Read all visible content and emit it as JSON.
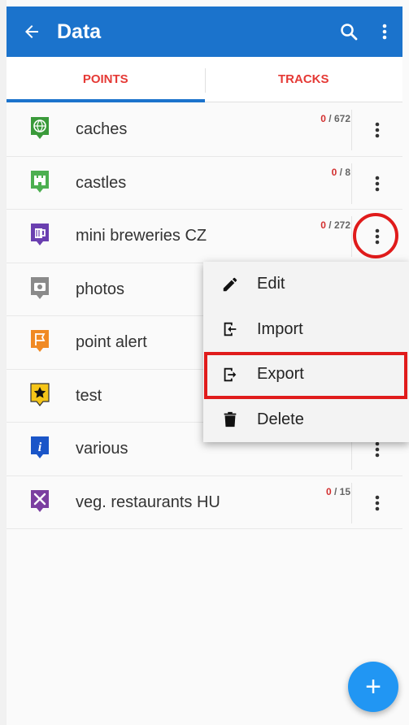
{
  "appbar": {
    "title": "Data"
  },
  "tabs": [
    {
      "label": "POINTS",
      "active": true
    },
    {
      "label": "TRACKS",
      "active": false
    }
  ],
  "rows": [
    {
      "label": "caches",
      "done": "0",
      "total": "672",
      "icon": "globe-icon",
      "color": "#3a9a3a"
    },
    {
      "label": "castles",
      "done": "0",
      "total": "8",
      "icon": "castle-icon",
      "color": "#4caf50"
    },
    {
      "label": "mini breweries CZ",
      "done": "0",
      "total": "272",
      "icon": "beer-icon",
      "color": "#6a3fb0"
    },
    {
      "label": "photos",
      "done": "",
      "total": "",
      "icon": "camera-icon",
      "color": "#8a8a8a"
    },
    {
      "label": "point alert",
      "done": "",
      "total": "",
      "icon": "flag-icon",
      "color": "#f08a24"
    },
    {
      "label": "test",
      "done": "",
      "total": "",
      "icon": "star-icon",
      "color": "#f5c518"
    },
    {
      "label": "various",
      "done": "",
      "total": "",
      "icon": "info-icon",
      "color": "#1a55c8"
    },
    {
      "label": "veg. restaurants HU",
      "done": "0",
      "total": "15",
      "icon": "fork-knife-icon",
      "color": "#7b3fa0"
    }
  ],
  "menu": {
    "items": [
      {
        "label": "Edit",
        "icon": "pencil-icon"
      },
      {
        "label": "Import",
        "icon": "import-icon"
      },
      {
        "label": "Export",
        "icon": "export-icon"
      },
      {
        "label": "Delete",
        "icon": "trash-icon"
      }
    ]
  },
  "fab": {
    "symbol": "+"
  },
  "colors": {
    "primary": "#1b73cc",
    "accent": "#e53935",
    "highlight": "#e01b1b",
    "fab": "#2196f3"
  }
}
